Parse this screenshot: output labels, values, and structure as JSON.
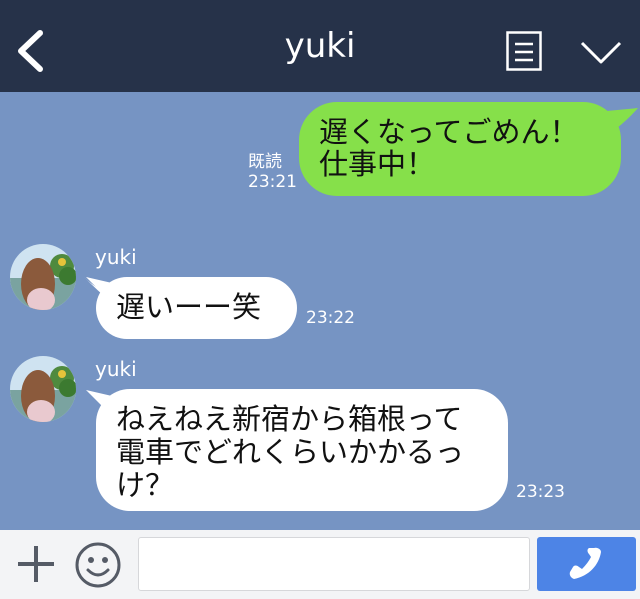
{
  "header": {
    "title": "yuki"
  },
  "messages": {
    "outgoing": {
      "line1": "遅くなってごめん！",
      "line2": "仕事中！",
      "read": "既読",
      "time": "23:21"
    },
    "incoming1": {
      "sender": "yuki",
      "text": "遅いーー笑",
      "time": "23:22"
    },
    "incoming2": {
      "sender": "yuki",
      "line1": "ねえねえ新宿から箱根って",
      "line2": "電車でどれくらいかかるっ",
      "line3": "け？",
      "time": "23:23"
    }
  },
  "input": {
    "value": "",
    "placeholder": ""
  },
  "colors": {
    "header": "#263249",
    "chat_bg": "#7694c3",
    "outgoing": "#86e04a",
    "incoming": "#ffffff",
    "call": "#4d84e6"
  },
  "icons": [
    "back-icon",
    "note-icon",
    "chevron-down-icon",
    "plus-icon",
    "smiley-icon",
    "phone-icon"
  ]
}
